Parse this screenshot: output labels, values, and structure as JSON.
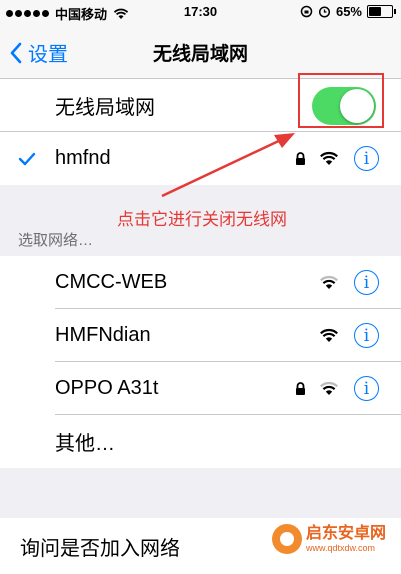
{
  "status_bar": {
    "carrier": "中国移动",
    "time": "17:30",
    "battery": "65%",
    "battery_level": 0.65
  },
  "nav": {
    "back_label": "设置",
    "title": "无线局域网"
  },
  "wifi_toggle": {
    "label": "无线局域网",
    "on": true
  },
  "connected": {
    "name": "hmfnd",
    "locked": true
  },
  "section_header": "选取网络…",
  "networks": [
    {
      "name": "CMCC-WEB",
      "locked": false
    },
    {
      "name": "HMFNdian",
      "locked": false
    },
    {
      "name": "OPPO A31t",
      "locked": true
    }
  ],
  "other_label": "其他…",
  "ask_join_label": "询问是否加入网络",
  "annotation": "点击它进行关闭无线网",
  "watermark": {
    "name": "启东安卓网",
    "url": "www.qdtxdw.com"
  },
  "colors": {
    "accent": "#007aff",
    "toggle_on": "#4cd964",
    "annotation": "#e53935"
  }
}
